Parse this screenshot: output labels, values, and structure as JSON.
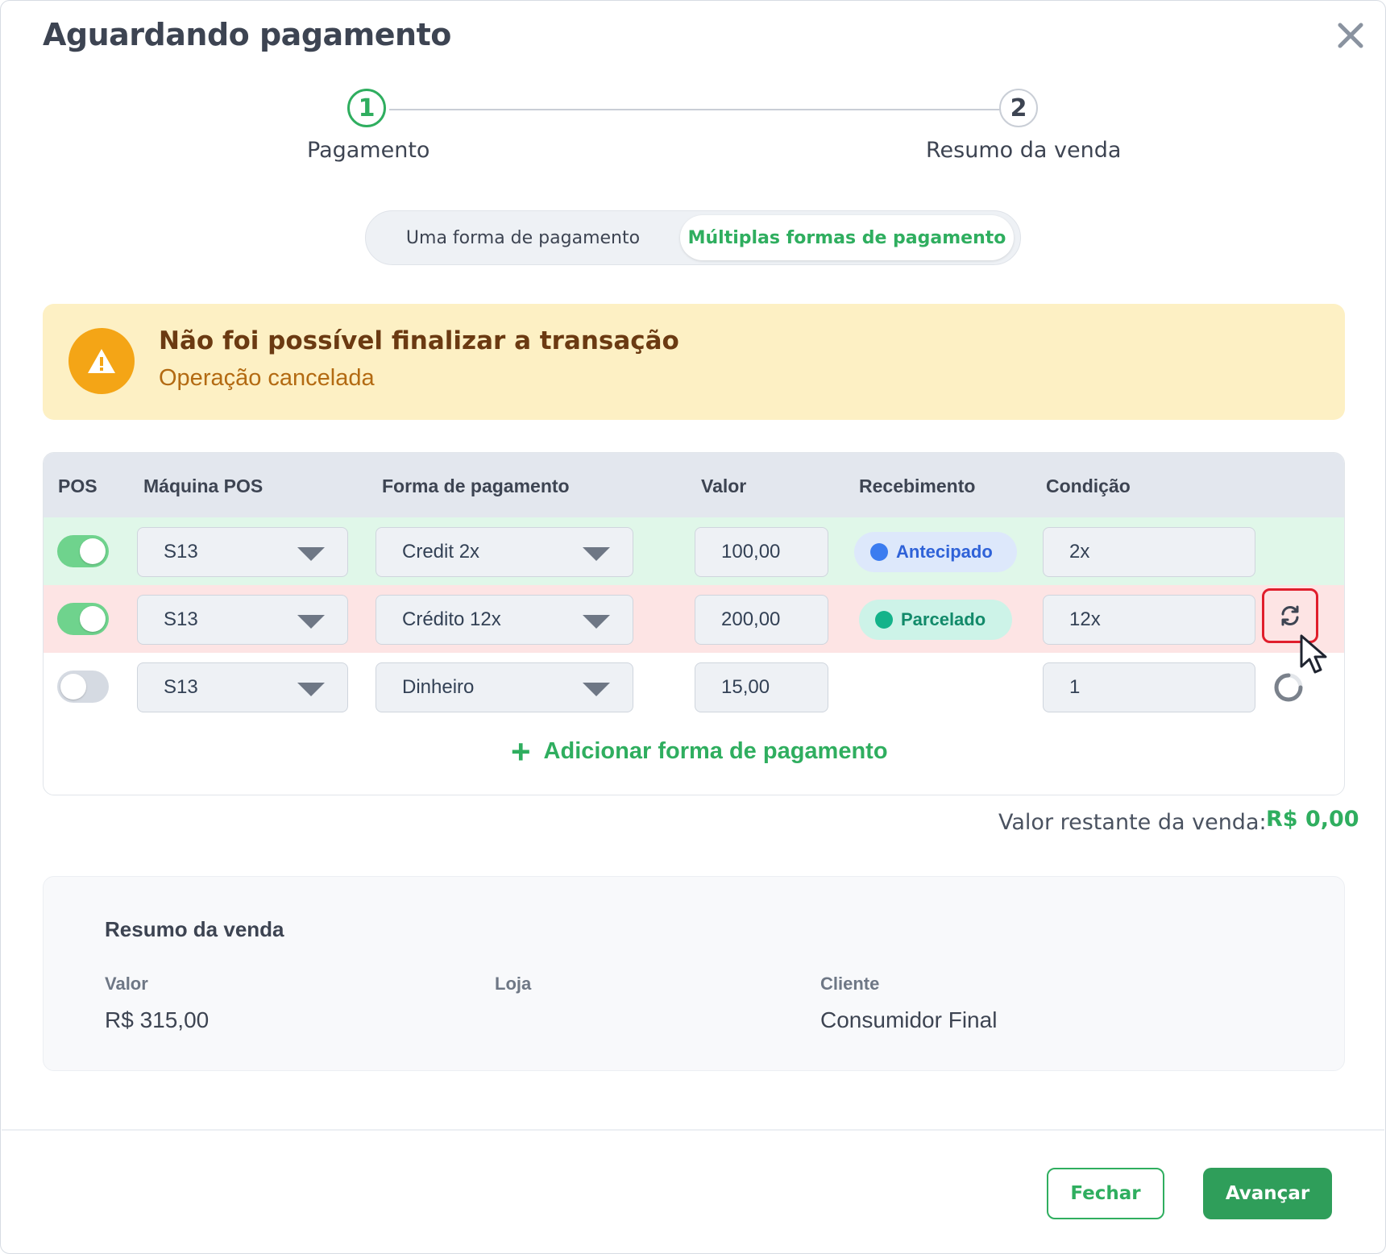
{
  "dialog": {
    "title": "Aguardando pagamento"
  },
  "stepper": {
    "steps": [
      {
        "number": "1",
        "label": "Pagamento",
        "state": "active"
      },
      {
        "number": "2",
        "label": "Resumo da venda",
        "state": "pending"
      }
    ]
  },
  "payment_mode": {
    "options": [
      "Uma forma de pagamento",
      "Múltiplas formas de pagamento"
    ],
    "selected": "Múltiplas formas de pagamento"
  },
  "alert": {
    "title": "Não foi possível finalizar a transação",
    "message": "Operação cancelada",
    "icon": "warning-icon"
  },
  "table": {
    "headers": [
      "POS",
      "Máquina POS",
      "Forma de pagamento",
      "Valor",
      "Recebimento",
      "Condição"
    ],
    "rows": [
      {
        "pos_enabled": true,
        "machine": "S13",
        "method": "Credit 2x",
        "amount": "100,00",
        "receipt": "Antecipado",
        "condition": "2x",
        "status": "success"
      },
      {
        "pos_enabled": true,
        "machine": "S13",
        "method": "Crédito 12x",
        "amount": "200,00",
        "receipt": "Parcelado",
        "condition": "12x",
        "status": "error"
      },
      {
        "pos_enabled": false,
        "machine": "S13",
        "method": "Dinheiro",
        "amount": "15,00",
        "receipt": "",
        "condition": "1",
        "status": "pending"
      }
    ],
    "add_label": "Adicionar forma de pagamento"
  },
  "remaining": {
    "label": "Valor restante da venda:",
    "value": "R$ 0,00"
  },
  "summary": {
    "title": "Resumo da venda",
    "fields": [
      {
        "label": "Valor",
        "value": "R$ 315,00"
      },
      {
        "label": "Loja",
        "value": ""
      },
      {
        "label": "Cliente",
        "value": "Consumidor Final"
      }
    ]
  },
  "footer": {
    "close_label": "Fechar",
    "next_label": "Avançar"
  },
  "colors": {
    "accent_green": "#2fae5f",
    "warning": "#f4a516",
    "error_border": "#e01e2c"
  }
}
